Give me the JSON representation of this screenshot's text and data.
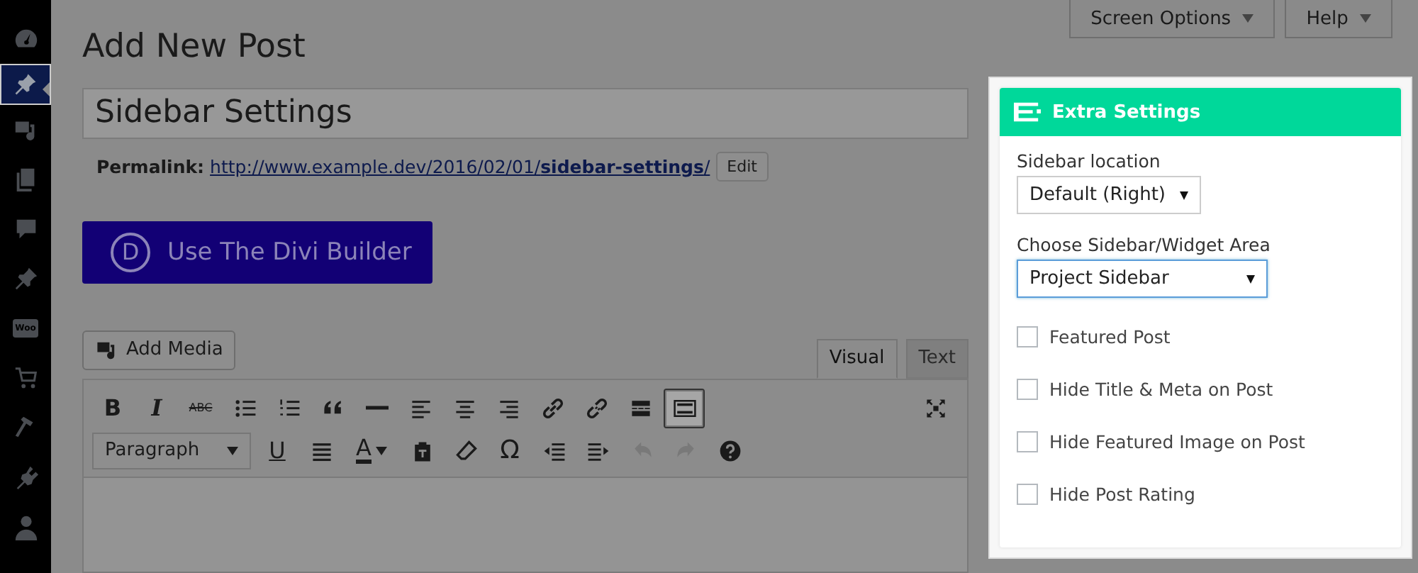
{
  "admin_menu": [
    {
      "kind": "dashboard",
      "selected": false
    },
    {
      "kind": "pin",
      "selected": true
    },
    {
      "kind": "media",
      "selected": false
    },
    {
      "kind": "pages",
      "selected": false
    },
    {
      "kind": "comment",
      "selected": false
    },
    {
      "kind": "pin",
      "selected": false
    },
    {
      "kind": "woo",
      "label": "Woo",
      "selected": false
    },
    {
      "kind": "cart",
      "selected": false
    },
    {
      "kind": "hammer",
      "selected": false
    },
    {
      "kind": "plug",
      "selected": false
    },
    {
      "kind": "user",
      "selected": false
    }
  ],
  "header_buttons": [
    "Screen Options",
    "Help"
  ],
  "page_title": "Add New Post",
  "post_title": {
    "value": "Sidebar Settings"
  },
  "permalink": {
    "label": "Permalink:",
    "url": "http://www.example.dev/2016/02/01/**sidebar-settings**/",
    "edit_button": "Edit"
  },
  "divi_button": {
    "logo": "D",
    "label": "Use The Divi Builder"
  },
  "add_media": "Add Media",
  "editor_tabs": [
    {
      "label": "Visual",
      "selected": true
    },
    {
      "label": "Text",
      "selected": false
    }
  ],
  "toolbar_rows": [
    [
      {
        "kind": "bold",
        "label": "B",
        "active": false,
        "disabled": false
      },
      {
        "kind": "italic",
        "label": "I",
        "active": false,
        "disabled": false
      },
      {
        "kind": "strike",
        "label": "ABC",
        "active": false,
        "disabled": false
      },
      {
        "kind": "bullets",
        "active": false,
        "disabled": false
      },
      {
        "kind": "numbers",
        "active": false,
        "disabled": false
      },
      {
        "kind": "quote",
        "active": false,
        "disabled": false
      },
      {
        "kind": "hr",
        "active": false,
        "disabled": false
      },
      {
        "kind": "align-left",
        "active": false,
        "disabled": false
      },
      {
        "kind": "align-center",
        "active": false,
        "disabled": false
      },
      {
        "kind": "align-right",
        "active": false,
        "disabled": false
      },
      {
        "kind": "link",
        "active": false,
        "disabled": false
      },
      {
        "kind": "unlink",
        "active": false,
        "disabled": false
      },
      {
        "kind": "more",
        "active": false,
        "disabled": false
      },
      {
        "kind": "toggle",
        "active": true,
        "disabled": false
      },
      {
        "kind": "fullscreen",
        "active": false,
        "disabled": false
      }
    ],
    [
      {
        "kind": "select",
        "label": "Paragraph",
        "active": false,
        "disabled": false
      },
      {
        "kind": "underline",
        "label": "U",
        "active": false,
        "disabled": false
      },
      {
        "kind": "justify",
        "active": false,
        "disabled": false
      },
      {
        "kind": "color",
        "label": "A",
        "active": false,
        "disabled": false
      },
      {
        "kind": "paste",
        "active": false,
        "disabled": false
      },
      {
        "kind": "eraser",
        "active": false,
        "disabled": false
      },
      {
        "kind": "symbol",
        "label": "Ω",
        "active": false,
        "disabled": false
      },
      {
        "kind": "outdent",
        "active": false,
        "disabled": false
      },
      {
        "kind": "indent",
        "active": false,
        "disabled": false
      },
      {
        "kind": "undo",
        "active": false,
        "disabled": true
      },
      {
        "kind": "redo",
        "active": false,
        "disabled": true
      },
      {
        "kind": "help",
        "active": false,
        "disabled": false
      }
    ]
  ],
  "extra_settings": {
    "title": "Extra Settings",
    "fields": [
      {
        "kind": "select",
        "label": "Sidebar location",
        "value": "Default (Right)",
        "focused": false
      },
      {
        "kind": "select",
        "label": "Choose Sidebar/Widget Area",
        "value": "Project Sidebar",
        "focused": true
      },
      {
        "kind": "checkbox",
        "label": "Featured Post",
        "checked": false
      },
      {
        "kind": "checkbox",
        "label": "Hide Title & Meta on Post",
        "checked": false
      },
      {
        "kind": "checkbox",
        "label": "Hide Featured Image on Post",
        "checked": false
      },
      {
        "kind": "checkbox",
        "label": "Hide Post Rating",
        "checked": false
      }
    ]
  }
}
